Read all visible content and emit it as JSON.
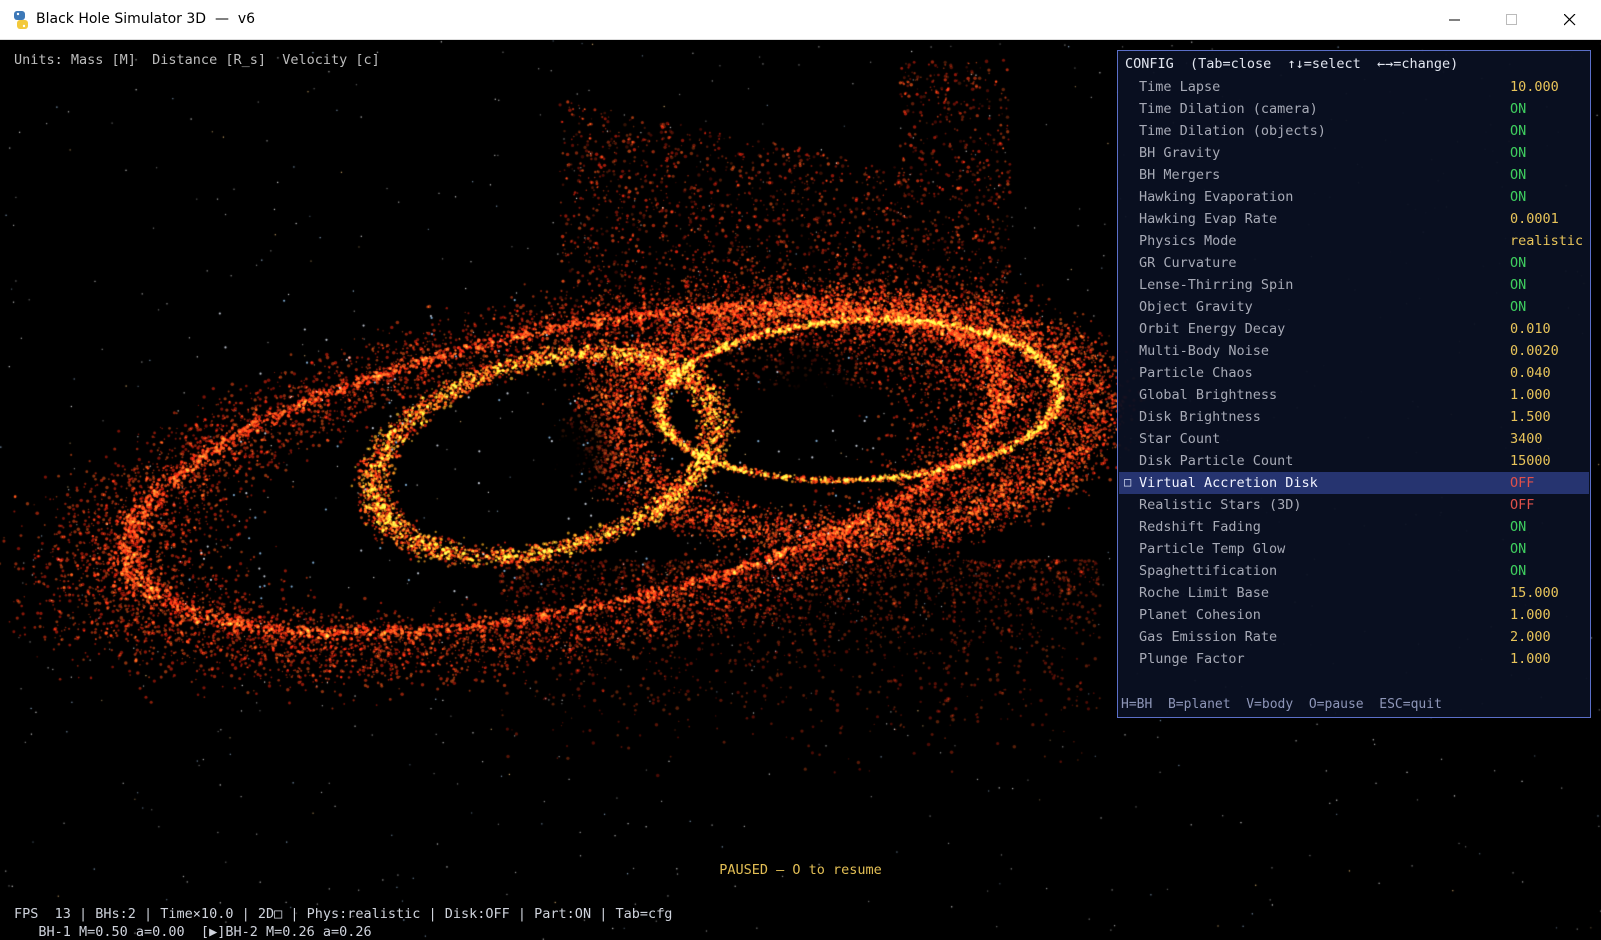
{
  "window": {
    "title": "Black Hole Simulator 3D  —  v6",
    "icon": "python-icon",
    "controls": [
      "minimize-icon",
      "maximize-icon",
      "close-icon"
    ]
  },
  "hud": {
    "units": "Units: Mass [M]  Distance [R_s]  Velocity [c]",
    "paused": "PAUSED — O to resume",
    "status": "FPS  13 | BHs:2 | Time×10.0 | 2D□ | Phys:realistic | Disk:OFF | Part:ON | Tab=cfg",
    "bh_line": "   BH-1 M=0.50 a=0.00  [▶]BH-2 M=0.26 a=0.26"
  },
  "config": {
    "header": "CONFIG  (Tab=close  ↑↓=select  ←→=change)",
    "selected_marker": "□",
    "items": [
      {
        "label": "Time Lapse",
        "value": "10.000"
      },
      {
        "label": "Time Dilation (camera)",
        "value": "ON"
      },
      {
        "label": "Time Dilation (objects)",
        "value": "ON"
      },
      {
        "label": "BH Gravity",
        "value": "ON"
      },
      {
        "label": "BH Mergers",
        "value": "ON"
      },
      {
        "label": "Hawking Evaporation",
        "value": "ON"
      },
      {
        "label": "Hawking Evap Rate",
        "value": "0.0001"
      },
      {
        "label": "Physics Mode",
        "value": "realistic"
      },
      {
        "label": "GR Curvature",
        "value": "ON"
      },
      {
        "label": "Lense-Thirring Spin",
        "value": "ON"
      },
      {
        "label": "Object Gravity",
        "value": "ON"
      },
      {
        "label": "Orbit Energy Decay",
        "value": "0.010"
      },
      {
        "label": "Multi-Body Noise",
        "value": "0.0020"
      },
      {
        "label": "Particle Chaos",
        "value": "0.040"
      },
      {
        "label": "Global Brightness",
        "value": "1.000"
      },
      {
        "label": "Disk Brightness",
        "value": "1.500"
      },
      {
        "label": "Star Count",
        "value": "3400"
      },
      {
        "label": "Disk Particle Count",
        "value": "15000"
      },
      {
        "label": "Virtual Accretion Disk",
        "value": "OFF",
        "selected": true
      },
      {
        "label": "Realistic Stars (3D)",
        "value": "OFF"
      },
      {
        "label": "Redshift Fading",
        "value": "ON"
      },
      {
        "label": "Particle Temp Glow",
        "value": "ON"
      },
      {
        "label": "Spaghettification",
        "value": "ON"
      },
      {
        "label": "Roche Limit Base",
        "value": "15.000"
      },
      {
        "label": "Planet Cohesion",
        "value": "1.000"
      },
      {
        "label": "Gas Emission Rate",
        "value": "2.000"
      },
      {
        "label": "Plunge Factor",
        "value": "1.000"
      }
    ],
    "footer": "H=BH  B=planet  V=body  O=pause  ESC=quit"
  },
  "colors": {
    "on": "#3fcf5f",
    "off": "#e0504a",
    "number": "#e8c45a",
    "paused": "#e3bf55",
    "disk_outer": "#ff2a10",
    "disk_inner": "#ffb020"
  }
}
